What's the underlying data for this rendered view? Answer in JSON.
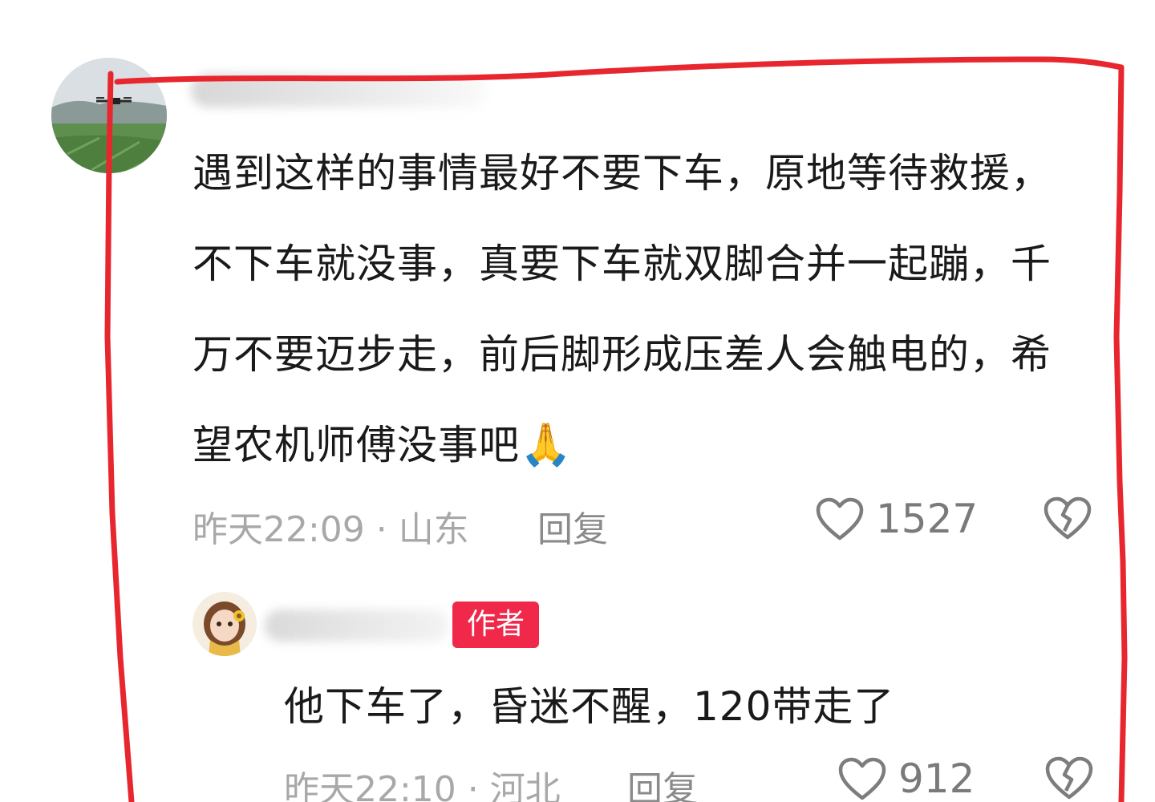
{
  "comment": {
    "text": "遇到这样的事情最好不要下车，原地等待救援，不下车就没事，真要下车就双脚合并一起蹦，千万不要迈步走，前后脚形成压差人会触电的，希望农机师傅没事吧",
    "emoji": "🙏",
    "time_location": "昨天22:09 · 山东",
    "reply_label": "回复",
    "likes": "1527"
  },
  "reply": {
    "badge": "作者",
    "text": "他下车了，昏迷不醒，120带走了",
    "time_location": "昨天22:10 · 河北",
    "reply_label": "回复",
    "likes": "912"
  },
  "colors": {
    "badge_bg": "#f0284a",
    "annotation_red": "#e8262e",
    "meta_gray": "#a8a8a8"
  },
  "icons": [
    "heart-outline-icon",
    "broken-heart-icon",
    "pray-emoji"
  ]
}
